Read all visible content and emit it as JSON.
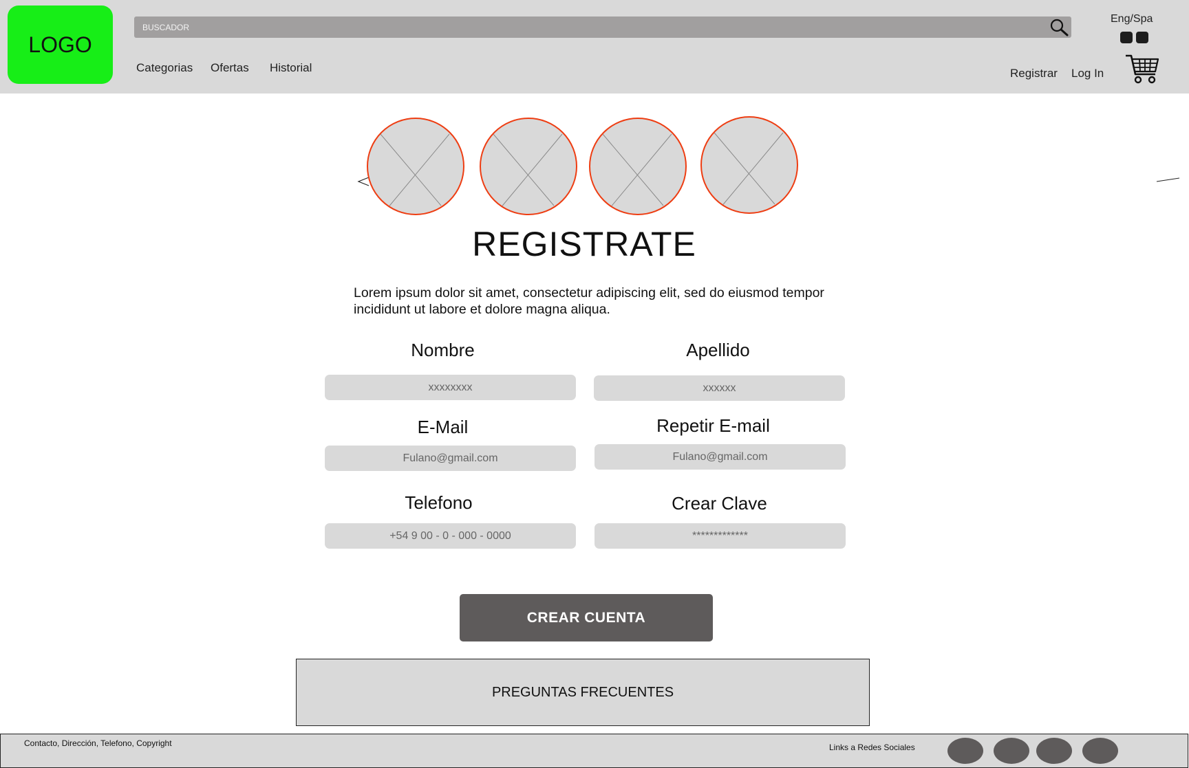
{
  "header": {
    "logo": "LOGO",
    "search_placeholder": "BUSCADOR",
    "nav": [
      "Categorias",
      "Ofertas",
      "Historial"
    ],
    "language": "Eng/Spa",
    "register": "Registrar",
    "login": "Log In"
  },
  "icons": {
    "search": "search-icon",
    "cart": "cart-icon",
    "prev": "chevron-left-icon",
    "next": "chevron-right-icon",
    "placeholder_image": "image-placeholder-icon"
  },
  "main": {
    "title": "REGISTRATE",
    "description": "Lorem ipsum dolor sit amet, consectetur adipiscing elit, sed do eiusmod tempor incididunt ut labore et dolore magna aliqua.",
    "fields": {
      "nombre": {
        "label": "Nombre",
        "placeholder": "xxxxxxxx"
      },
      "apellido": {
        "label": "Apellido",
        "placeholder": "xxxxxx"
      },
      "email": {
        "label": "E-Mail",
        "placeholder": "Fulano@gmail.com"
      },
      "repeat_email": {
        "label": "Repetir E-mail",
        "placeholder": "Fulano@gmail.com"
      },
      "telefono": {
        "label": "Telefono",
        "placeholder": "+54 9 00 - 0 - 000 - 0000"
      },
      "clave": {
        "label": "Crear Clave",
        "placeholder": "*************"
      }
    },
    "submit": "CREAR CUENTA",
    "faq": "PREGUNTAS FRECUENTES"
  },
  "footer": {
    "info": "Contacto, Dirección, Telefono, Copyright",
    "social_label": "Links a Redes Sociales"
  },
  "colors": {
    "logo_bg": "#17ee17",
    "header_bg": "#d9d9d9",
    "circle_border": "#ee3d12",
    "button_bg": "#5e5b5b"
  }
}
